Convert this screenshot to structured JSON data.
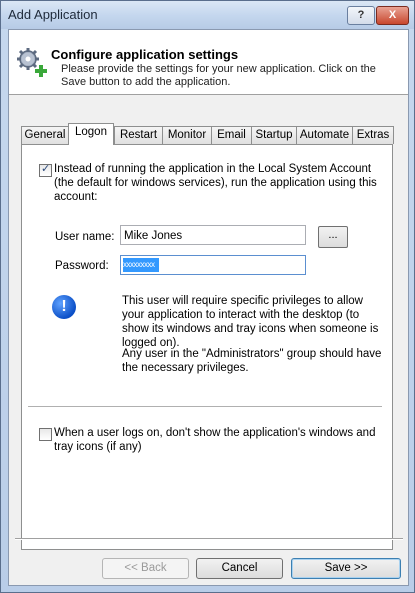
{
  "window": {
    "title": "Add Application",
    "help_label": "?",
    "close_label": "X"
  },
  "header": {
    "title": "Configure application settings",
    "description": "Please provide the settings for your new application. Click on the Save button to add the application.",
    "icon": "gears-add-icon"
  },
  "tabs": [
    {
      "label": "General"
    },
    {
      "label": "Logon",
      "active": true
    },
    {
      "label": "Restart"
    },
    {
      "label": "Monitor"
    },
    {
      "label": "Email"
    },
    {
      "label": "Startup"
    },
    {
      "label": "Automate"
    },
    {
      "label": "Extras"
    }
  ],
  "logon": {
    "run_as_checkbox_checked": true,
    "run_as_text": "Instead of running the application in the Local System Account (the default for windows services), run the application using this account:",
    "user_name_label": "User name:",
    "user_name_value": "Mike Jones",
    "browse_label": "...",
    "password_label": "Password:",
    "password_mask": "xxxxxxxxx",
    "info_icon": "exclamation-info-icon",
    "info_text_1": "This user will require specific privileges to allow your application to interact with the desktop (to show its windows and tray icons when someone is logged on).",
    "info_text_2": "Any user in the \"Administrators\" group should have the necessary privileges.",
    "hide_windows_checked": false,
    "hide_windows_text": "When a user logs on, don't show the application's windows and tray icons (if any)"
  },
  "buttons": {
    "back": "<< Back",
    "cancel": "Cancel",
    "save": "Save >>"
  }
}
